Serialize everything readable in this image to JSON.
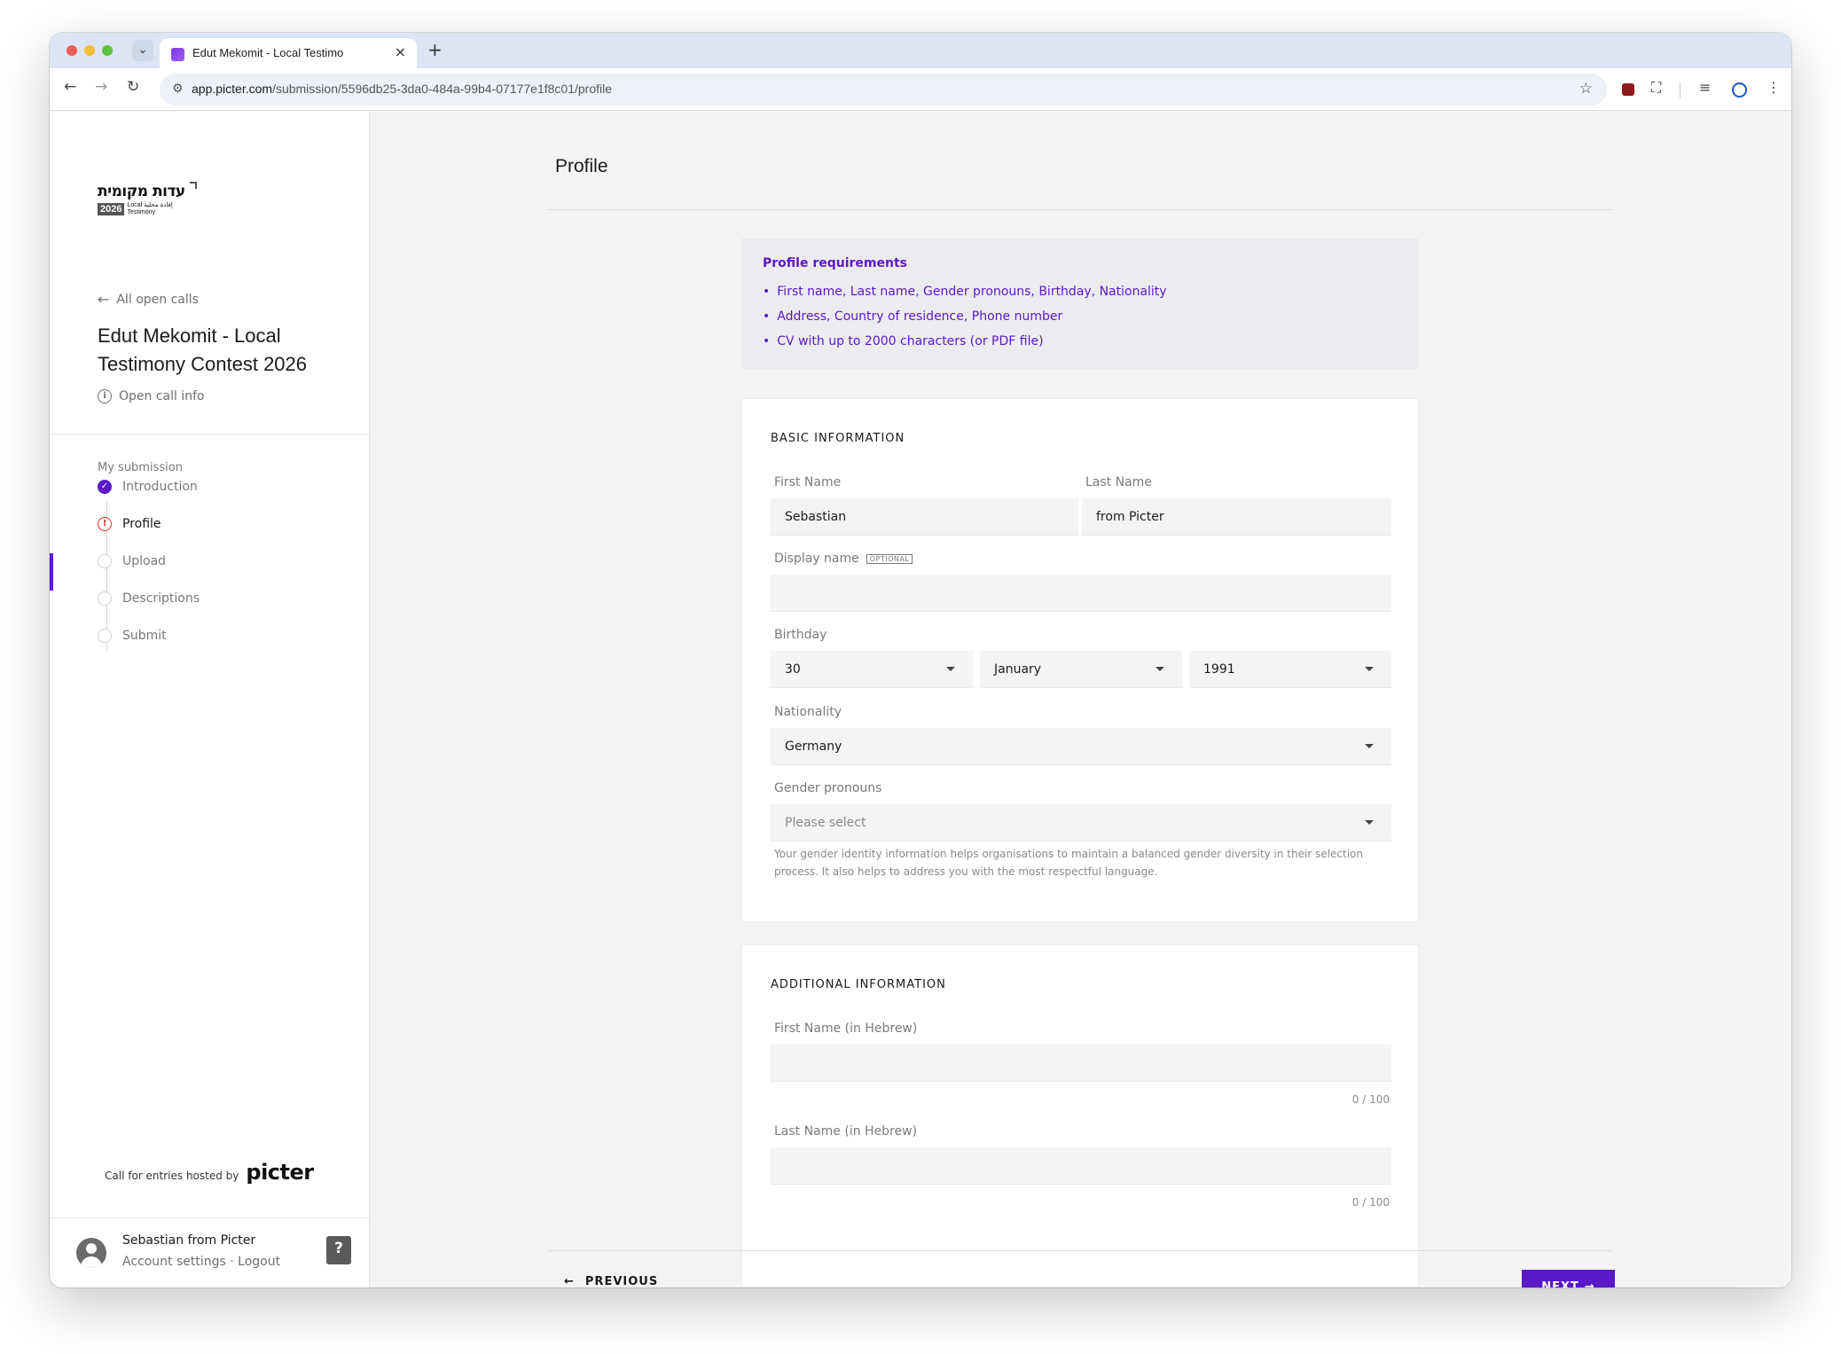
{
  "browser": {
    "tab_title": "Edut Mekomit - Local Testimo",
    "url_host": "app.picter.com",
    "url_path": "/submission/5596db25-3da0-484a-99b4-07177e1f8c01/profile"
  },
  "sidebar": {
    "logo": {
      "hebrew": "עדות מקומית",
      "year": "2026",
      "arabic": "إفادة محلية",
      "local": "Local",
      "testimony": "Testimony"
    },
    "back_label": "All open calls",
    "call_title": "Edut Mekomit - Local Testimony Contest 2026",
    "info_label": "Open call info",
    "steps_label": "My submission",
    "steps": [
      {
        "label": "Introduction",
        "state": "done"
      },
      {
        "label": "Profile",
        "state": "error"
      },
      {
        "label": "Upload",
        "state": "pending"
      },
      {
        "label": "Descriptions",
        "state": "pending"
      },
      {
        "label": "Submit",
        "state": "pending"
      }
    ],
    "hosted_label": "Call for entries hosted by",
    "hosted_brand": "picter",
    "user_name": "Sebastian from Picter",
    "account_settings": "Account settings",
    "separator": "·",
    "logout": "Logout",
    "help_label": "?"
  },
  "main": {
    "page_title": "Profile",
    "requirements": {
      "title": "Profile requirements",
      "items": [
        "First name, Last name, Gender pronouns, Birthday, Nationality",
        "Address, Country of residence, Phone number",
        "CV with up to 2000 characters (or PDF file)"
      ]
    },
    "basic": {
      "heading": "BASIC INFORMATION",
      "first_name_label": "First Name",
      "first_name_value": "Sebastian",
      "last_name_label": "Last Name",
      "last_name_value": "from Picter",
      "display_name_label": "Display name",
      "optional_badge": "OPTIONAL",
      "display_name_value": "",
      "birthday_label": "Birthday",
      "birthday_day": "30",
      "birthday_month": "January",
      "birthday_year": "1991",
      "nationality_label": "Nationality",
      "nationality_value": "Germany",
      "gender_label": "Gender pronouns",
      "gender_placeholder": "Please select",
      "gender_helper": "Your gender identity information helps organisations to maintain a balanced gender diversity in their selection process. It also helps to address you with the most respectful language."
    },
    "additional": {
      "heading": "ADDITIONAL INFORMATION",
      "first_name_he_label": "First Name (in Hebrew)",
      "first_name_he_counter": "0 / 100",
      "last_name_he_label": "Last Name (in Hebrew)",
      "last_name_he_counter": "0 / 100"
    },
    "prev_label": "PREVIOUS",
    "next_label": "NEXT"
  }
}
